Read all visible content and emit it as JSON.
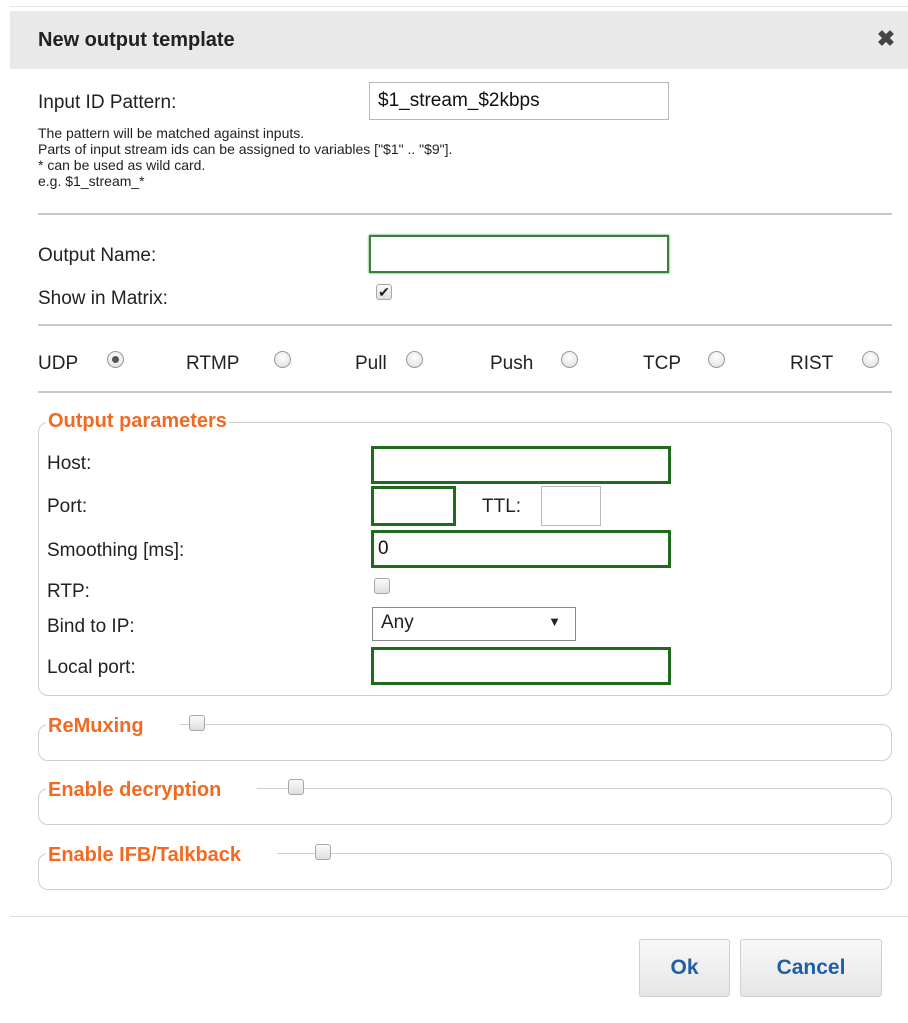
{
  "dialog": {
    "title": "New output template",
    "close_glyph": "✖"
  },
  "input_id": {
    "label": "Input ID Pattern:",
    "value": "$1_stream_$2kbps",
    "help": [
      "The pattern will be matched against inputs.",
      "Parts of input stream ids can be assigned to variables [\"$1\" .. \"$9\"].",
      "* can be used as wild card.",
      "e.g. $1_stream_*"
    ]
  },
  "output_name": {
    "label": "Output Name:",
    "value": ""
  },
  "show_in_matrix": {
    "label": "Show in Matrix:",
    "checked": true,
    "check_glyph": "✔"
  },
  "protocols": [
    {
      "label": "UDP",
      "selected": true
    },
    {
      "label": "RTMP",
      "selected": false
    },
    {
      "label": "Pull",
      "selected": false
    },
    {
      "label": "Push",
      "selected": false
    },
    {
      "label": "TCP",
      "selected": false
    },
    {
      "label": "RIST",
      "selected": false
    }
  ],
  "output_parameters": {
    "legend": "Output parameters",
    "host_label": "Host:",
    "host_value": "",
    "port_label": "Port:",
    "port_value": "",
    "ttl_label": "TTL:",
    "ttl_value": "",
    "smoothing_label": "Smoothing [ms]:",
    "smoothing_value": "0",
    "rtp_label": "RTP:",
    "rtp_checked": false,
    "bind_label": "Bind to IP:",
    "bind_value": "Any",
    "bind_arrow": "▼",
    "local_port_label": "Local port:",
    "local_port_value": ""
  },
  "sections": {
    "remuxing": "ReMuxing",
    "decryption": "Enable decryption",
    "ifb": "Enable IFB/Talkback"
  },
  "buttons": {
    "ok": "Ok",
    "cancel": "Cancel"
  },
  "colors": {
    "accent_orange": "#f26a21",
    "button_text": "#1f5fa7",
    "input_border_green": "#1e6b1e"
  },
  "icons": {
    "close": "close-icon",
    "dropdown": "chevron-down-icon"
  }
}
